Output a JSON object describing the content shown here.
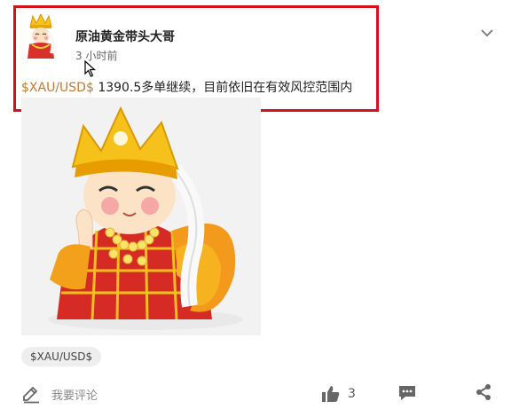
{
  "post": {
    "author": "原油黄金带头大哥",
    "time": "3 小时前",
    "ticker": "$XAU/USD$",
    "text": " 1390.5多单继续，目前依旧在有效风控范围内",
    "tag": "$XAU/USD$"
  },
  "actions": {
    "comment_label": "我要评论",
    "like_count": "3"
  },
  "icons": {
    "avatar": "cartoon-monk-avatar",
    "chevron": "chevron-down-icon",
    "comment": "pencil-edit-icon",
    "like": "thumbs-up-icon",
    "reply": "chat-bubble-icon",
    "share": "share-icon"
  },
  "colors": {
    "highlight_border": "#d4101a",
    "ticker": "#c27a35",
    "icon_gray": "#666666"
  }
}
